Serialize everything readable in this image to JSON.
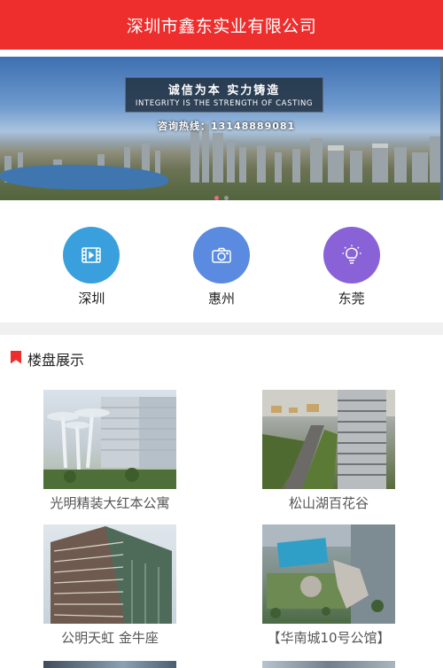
{
  "header": {
    "title": "深圳市鑫东实业有限公司"
  },
  "banner": {
    "slogan_cn": "诚信为本 实力铸造",
    "slogan_en": "INTEGRITY IS THE STRENGTH OF CASTING",
    "hotline": "咨询热线：13148889081",
    "slide_count": 2,
    "active_slide": 1
  },
  "nav": {
    "items": [
      {
        "label": "深圳",
        "icon": "film-icon",
        "color": "#3aa0dd"
      },
      {
        "label": "惠州",
        "icon": "camera-icon",
        "color": "#5a8be0"
      },
      {
        "label": "东莞",
        "icon": "lightbulb-icon",
        "color": "#8a62d8"
      }
    ]
  },
  "section": {
    "title": "楼盘展示",
    "properties": [
      {
        "name": "光明精装大红本公寓"
      },
      {
        "name": "松山湖百花谷"
      },
      {
        "name": "公明天虹 金牛座"
      },
      {
        "name": "【华南城10号公馆】"
      }
    ]
  },
  "colors": {
    "brand": "#ee2d2d"
  }
}
